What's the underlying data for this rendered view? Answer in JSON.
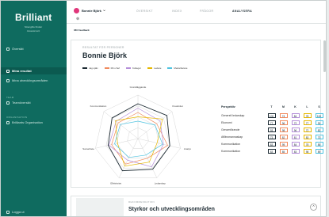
{
  "sidebar": {
    "logo": "Brilliant",
    "logo_sub": "Strengths Finder Assessment",
    "items": [
      {
        "label": "Översikt",
        "icon": "home-icon"
      },
      {
        "label": "Mina resultat",
        "icon": "chart-icon",
        "active": true
      },
      {
        "label": "Mina utvecklingsområden",
        "icon": "target-icon"
      }
    ],
    "section_team": "TEAM",
    "team_items": [
      {
        "label": "Teamöversikt",
        "icon": "users-icon"
      }
    ],
    "section_org": "ORGANISATION",
    "org_items": [
      {
        "label": "Brilliants Organisation",
        "icon": "org-icon"
      }
    ],
    "logout": "Logga ut"
  },
  "topbar": {
    "user": "Bonnie Björk",
    "tabs": [
      "ÖVERSIKT",
      "INDEX",
      "FRÅGOR",
      "ANALYSERA"
    ],
    "active_tab": "ANALYSERA",
    "sub_label": "360 Feedback"
  },
  "card": {
    "header_label": "RESULTAT FÖR PERSONER",
    "title": "Bonnie Björk",
    "legend": [
      {
        "label": "Jag själv",
        "color": "#1d2b33"
      },
      {
        "label": "Min chef",
        "color": "#f08a5d"
      },
      {
        "label": "Kollegor",
        "color": "#b58fd9"
      },
      {
        "label": "Ledare",
        "color": "#e6b800"
      },
      {
        "label": "Medarbetare",
        "color": "#4fc3e0"
      }
    ]
  },
  "chart_data": {
    "type": "radar",
    "axes": [
      "Grundläggande",
      "Kreativitet",
      "Analys",
      "Ledarskap",
      "Effektivitet",
      "Samarbete",
      "Kommunikation"
    ],
    "series": [
      {
        "name": "Jag själv",
        "values": [
          80,
          85,
          75,
          78,
          82,
          70,
          76
        ]
      },
      {
        "name": "Min chef",
        "values": [
          60,
          55,
          70,
          50,
          65,
          62,
          58
        ]
      },
      {
        "name": "Kollegor",
        "values": [
          70,
          65,
          60,
          72,
          55,
          68,
          64
        ]
      },
      {
        "name": "Ledare",
        "values": [
          50,
          72,
          45,
          60,
          70,
          48,
          66
        ]
      },
      {
        "name": "Medarbetare",
        "values": [
          40,
          50,
          58,
          42,
          48,
          55,
          52
        ]
      }
    ],
    "max": 100
  },
  "table": {
    "headers": [
      "Perspektiv",
      "T",
      "M",
      "K",
      "L",
      "S"
    ],
    "rows": [
      {
        "label": "Generell ledarskap",
        "values": [
          "100",
          "74",
          "84",
          "78",
          "100"
        ]
      },
      {
        "label": "Ekonomi",
        "values": [
          "77",
          "96",
          "72",
          "77",
          "93"
        ]
      },
      {
        "label": "Genomförande",
        "values": [
          "93",
          "98",
          "96",
          "72",
          "82"
        ]
      },
      {
        "label": "Affärsmannaskap",
        "values": [
          "73",
          "82",
          "81",
          "83",
          "73"
        ]
      },
      {
        "label": "Kommunikation",
        "values": [
          "83",
          "95",
          "84",
          "78",
          "85"
        ]
      },
      {
        "label": "Kommunikation",
        "values": [
          "83",
          "85",
          "83",
          "98",
          "89"
        ]
      }
    ]
  },
  "card2": {
    "label": "REKOMMENDATION",
    "title": "Styrkor och utvecklingsområden"
  }
}
